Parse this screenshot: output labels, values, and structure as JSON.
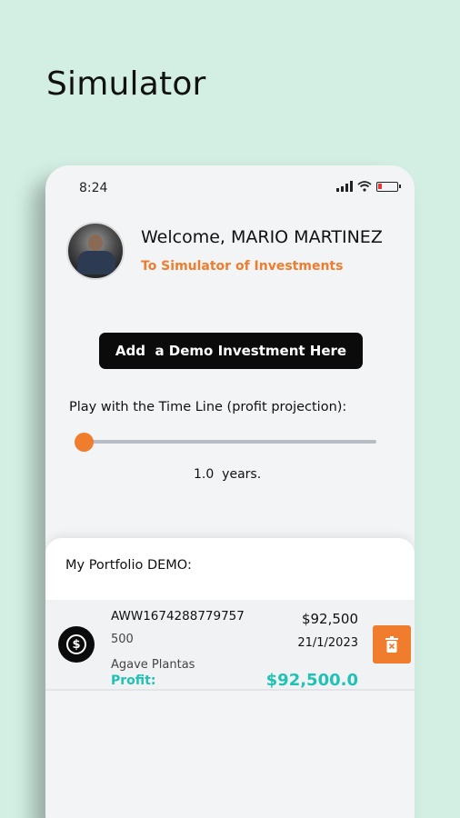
{
  "promo": {
    "title": "Simulator"
  },
  "status_bar": {
    "time": "8:24"
  },
  "header": {
    "welcome": "Welcome, MARIO MARTINEZ",
    "subtitle": "To Simulator of Investments"
  },
  "actions": {
    "add_demo_label": "Add  a Demo Investment Here"
  },
  "timeline": {
    "label": "Play with the Time Line (profit projection):",
    "years_text": "1.0  years.",
    "value_years": 1.0
  },
  "portfolio": {
    "title": "My Portfolio DEMO:",
    "items": [
      {
        "id": "AWW1674288779757",
        "quantity": "500",
        "name": "Agave Plantas",
        "profit_label": "Profit:",
        "price": "$92,500",
        "date": "21/1/2023",
        "profit_value": "$92,500.0"
      }
    ]
  },
  "icons": {
    "coin": "dollar-coin-icon",
    "delete": "trash-icon",
    "signal": "signal-icon",
    "wifi": "wifi-icon",
    "battery": "battery-icon"
  },
  "colors": {
    "background": "#d3efe3",
    "accent": "#ef7d2d",
    "profit": "#21c1b5",
    "button": "#0b0b0b"
  }
}
